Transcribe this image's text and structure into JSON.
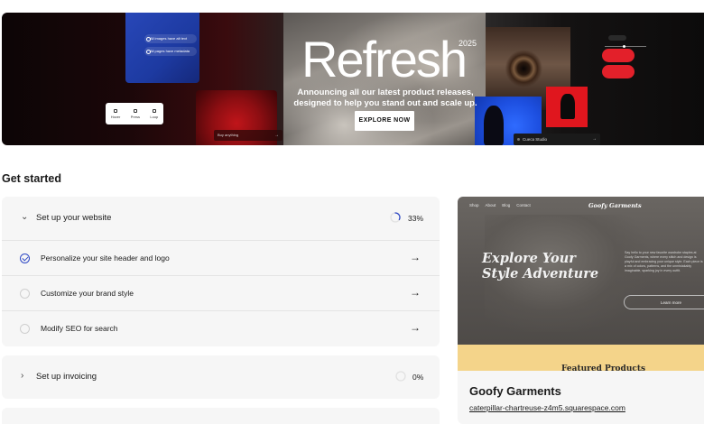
{
  "banner": {
    "title": "Refresh",
    "year": "2025",
    "tagline_line1": "Announcing all our latest product releases,",
    "tagline_line2": "designed to help you stand out and scale up.",
    "cta_label": "EXPLORE NOW",
    "mock_pills": [
      "All images have alt text",
      "All pages have metadata"
    ],
    "mock_tools": [
      "Hover",
      "Press",
      "Loop"
    ],
    "mock_search": "Buy anything",
    "mock_studio": "Cueca Studio"
  },
  "get_started": {
    "title": "Get started",
    "groups": [
      {
        "label": "Set up your website",
        "progress": "33%",
        "progress_fraction": 0.33,
        "expanded": true,
        "tasks": [
          {
            "label": "Personalize your site header and logo",
            "done": true
          },
          {
            "label": "Customize your brand style",
            "done": false
          },
          {
            "label": "Modify SEO for search",
            "done": false
          }
        ]
      },
      {
        "label": "Set up invoicing",
        "progress": "0%",
        "progress_fraction": 0,
        "expanded": false
      }
    ]
  },
  "site": {
    "name": "Goofy Garments",
    "url": "caterpillar-chartreuse-z4m5.squarespace.com",
    "preview": {
      "nav": [
        "Shop",
        "About",
        "Blog",
        "Contact"
      ],
      "logo": "Goofy Garments",
      "headline_line1": "Explore Your",
      "headline_line2": "Style Adventure",
      "paragraph": "Say hello to your new favorite wardrobe staples at Goofy Garments, where every stitch and design is playful and embracing your unique style. Each piece is a mix of colors, patterns, and the unmistakably imaginable, sparking joy in every outfit.",
      "learn_more": "Learn more",
      "featured": "Featured Products"
    }
  },
  "colors": {
    "accent_blue": "#2f49c5",
    "card_bg": "#f6f6f6",
    "banner_red": "#e0161e",
    "featured_yellow": "#f4d48a"
  },
  "icons": {
    "expanded": "chevron-down-icon",
    "collapsed": "chevron-right-icon",
    "task_done": "check-circle-icon",
    "task_todo": "empty-circle-icon",
    "go": "arrow-right-icon"
  }
}
